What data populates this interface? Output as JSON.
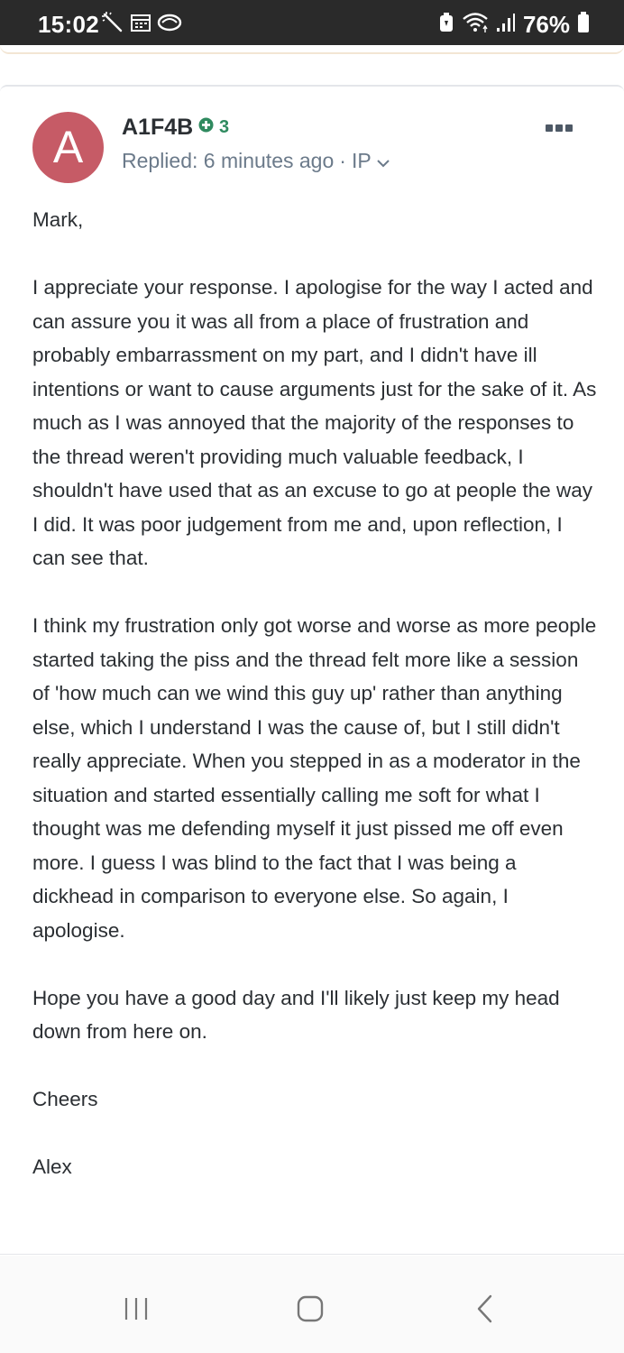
{
  "status_bar": {
    "time": "15:02",
    "battery_percent": "76%",
    "left_icons": [
      "magic-wand-icon",
      "calendar-icon",
      "cloud-icon"
    ],
    "right_icons": [
      "battery-saver-icon",
      "wifi-icon",
      "signal-icon",
      "battery-icon"
    ]
  },
  "post": {
    "avatar_letter": "A",
    "avatar_color": "#c65b66",
    "author": "A1F4B",
    "reputation": "3",
    "replied_label": "Replied: 6 minutes ago",
    "separator": "·",
    "ip_label": "IP",
    "body": [
      "Mark,",
      "I appreciate your response. I apologise for the way I acted and can assure you it was all from a place of frustration and probably embarrassment on my part, and I didn't have ill intentions or want to cause arguments just for the sake of it. As much as I was annoyed that the majority of the responses to the thread weren't providing much valuable feedback, I shouldn't have used that as an excuse to go at people the way I did. It was poor judgement from me and, upon reflection, I can see that.",
      "I think my frustration only got worse and worse as more people started taking the piss and the thread felt more like a session of 'how much can we wind this guy up' rather than anything else, which I understand I was the cause of, but I still didn't really appreciate. When you stepped in as a moderator in the situation and started essentially calling me soft for what I thought was me defending myself it just pissed me off even more. I guess I was blind to the fact that I was being a dickhead in comparison to everyone else. So again, I apologise.",
      "Hope you have a good day and I'll likely just keep my head down from here on.",
      "Cheers",
      "Alex"
    ]
  },
  "nav_bar": {
    "buttons": [
      "recent-apps-icon",
      "home-icon",
      "back-icon"
    ]
  },
  "colors": {
    "status_bar_bg": "#2a2a2a",
    "reputation_green": "#2f8a5f",
    "meta_gray": "#6b7a8a",
    "body_text": "#2b2f33"
  }
}
